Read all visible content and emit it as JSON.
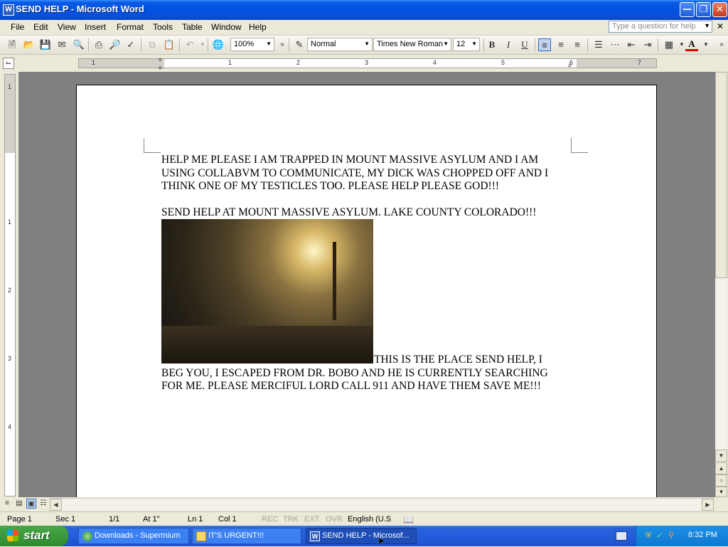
{
  "window": {
    "title": "SEND HELP - Microsoft Word",
    "app_icon": "W"
  },
  "menu": [
    "File",
    "Edit",
    "View",
    "Insert",
    "Format",
    "Tools",
    "Table",
    "Window",
    "Help"
  ],
  "help_search": {
    "placeholder": "Type a question for help"
  },
  "toolbar": {
    "zoom": "100%",
    "style": "Normal",
    "font": "Times New Roman",
    "size": "12",
    "bold": "B",
    "italic": "I",
    "underline": "U"
  },
  "ruler": {
    "h_numbers": [
      "1",
      "1",
      "2",
      "3",
      "4",
      "5",
      "6",
      "7"
    ],
    "v_numbers": [
      "1",
      "1",
      "2",
      "3",
      "4"
    ]
  },
  "document": {
    "paragraph1": [
      "HELP ME PLEASE I AM TRAPPED IN MOUNT MASSIVE ASYLUM AND I AM",
      "USING COLLABVM TO COMMUNICATE, MY DICK WAS CHOPPED OFF AND I",
      "THINK ONE OF MY TESTICLES TOO. PLEASE HELP PLEASE GOD!!!"
    ],
    "paragraph2": "SEND HELP AT MOUNT MASSIVE ASYLUM. LAKE COUNTY COLORADO!!!",
    "paragraph3": [
      "THIS IS THE PLACE SEND HELP, I",
      "BEG YOU, I ESCAPED FROM DR. BOBO AND HE IS CURRENTLY SEARCHING",
      "FOR ME. PLEASE MERCIFUL LORD CALL 911 AND HAVE THEM SAVE ME!!!"
    ]
  },
  "status": {
    "page": "Page 1",
    "sec": "Sec 1",
    "pages": "1/1",
    "at": "At 1\"",
    "ln": "Ln 1",
    "col": "Col 1",
    "rec": "REC",
    "trk": "TRK",
    "ext": "EXT",
    "ovr": "OVR",
    "language": "English (U.S"
  },
  "taskbar": {
    "start": "start",
    "tasks": [
      "Downloads - Supermium",
      "IT'S URGENT!!!",
      "SEND HELP - Microsof..."
    ],
    "clock": "8:32 PM"
  },
  "colors": {
    "titlebar": "#0052e0",
    "taskbar": "#245edc",
    "start": "#3c9a3c",
    "workspace": "#808080"
  }
}
